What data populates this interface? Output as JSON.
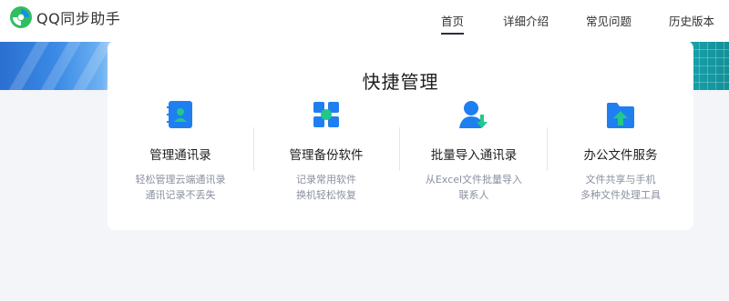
{
  "header": {
    "logo_text": "QQ同步助手",
    "nav": [
      {
        "label": "首页",
        "active": true
      },
      {
        "label": "详细介绍",
        "active": false
      },
      {
        "label": "常见问题",
        "active": false
      },
      {
        "label": "历史版本",
        "active": false
      }
    ]
  },
  "quick": {
    "title": "快捷管理",
    "features": [
      {
        "name": "管理通讯录",
        "desc": [
          "轻松管理云端通讯录",
          "通讯记录不丢失"
        ],
        "icon": "contacts-book-icon"
      },
      {
        "name": "管理备份软件",
        "desc": [
          "记录常用软件",
          "换机轻松恢复"
        ],
        "icon": "app-grid-icon"
      },
      {
        "name": "批量导入通讯录",
        "desc": [
          "从Excel文件批量导入",
          "联系人"
        ],
        "icon": "user-import-icon"
      },
      {
        "name": "办公文件服务",
        "desc": [
          "文件共享与手机",
          "多种文件处理工具"
        ],
        "icon": "folder-upload-icon"
      }
    ]
  },
  "colors": {
    "icon_blue": "#1f7ff0",
    "icon_green": "#22c88a",
    "nav_underline": "#2c2c3a",
    "desc_gray": "#8a90a0"
  }
}
